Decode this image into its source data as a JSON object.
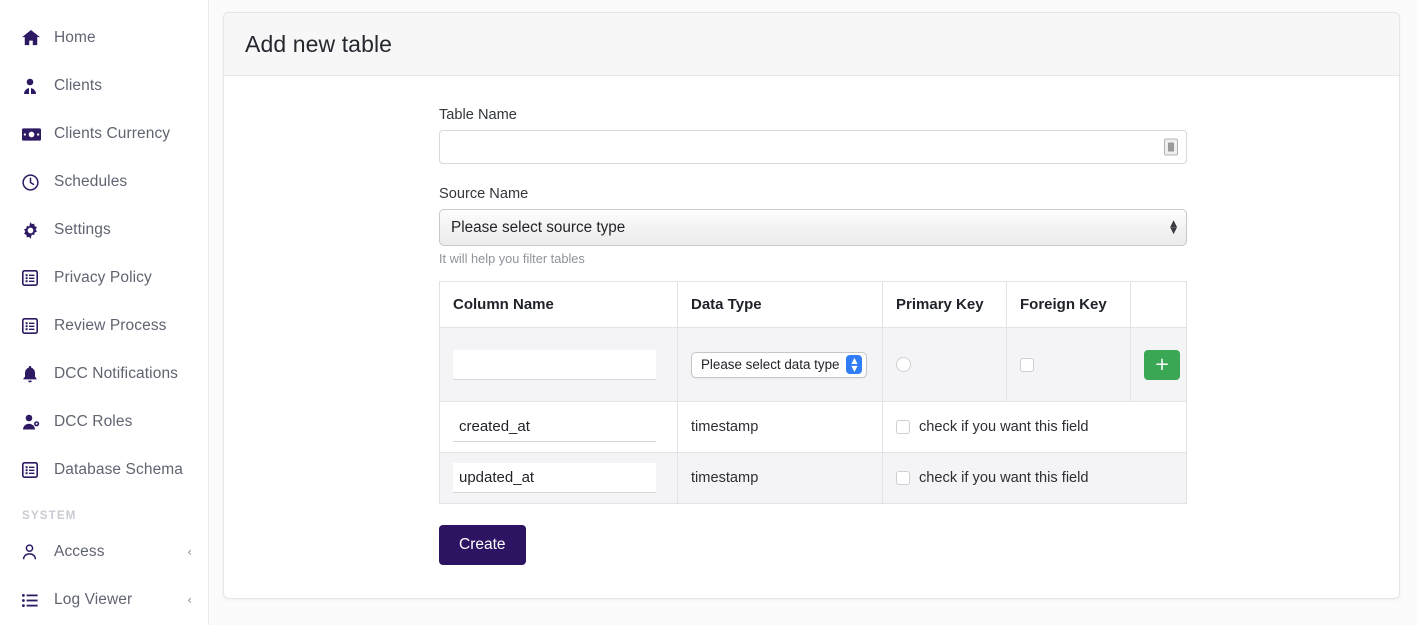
{
  "sidebar": {
    "items": [
      {
        "label": "Home",
        "icon": "home-icon",
        "chevron": ""
      },
      {
        "label": "Clients",
        "icon": "user-tie-icon",
        "chevron": ""
      },
      {
        "label": "Clients Currency",
        "icon": "money-bill-icon",
        "chevron": ""
      },
      {
        "label": "Schedules",
        "icon": "clock-icon",
        "chevron": ""
      },
      {
        "label": "Settings",
        "icon": "gear-icon",
        "chevron": ""
      },
      {
        "label": "Privacy Policy",
        "icon": "list-box-icon",
        "chevron": ""
      },
      {
        "label": "Review Process",
        "icon": "list-box-icon",
        "chevron": ""
      },
      {
        "label": "DCC Notifications",
        "icon": "bell-icon",
        "chevron": ""
      },
      {
        "label": "DCC Roles",
        "icon": "user-gear-icon",
        "chevron": ""
      },
      {
        "label": "Database Schema",
        "icon": "list-box-icon",
        "chevron": ""
      }
    ],
    "section_label": "SYSTEM",
    "system_items": [
      {
        "label": "Access",
        "icon": "user-outline-icon",
        "chevron": "‹"
      },
      {
        "label": "Log Viewer",
        "icon": "bullet-list-icon",
        "chevron": "‹"
      }
    ]
  },
  "page": {
    "title": "Add new table"
  },
  "form": {
    "table_name_label": "Table Name",
    "table_name_value": "",
    "table_name_placeholder": "",
    "source_name_label": "Source Name",
    "source_name_selected": "Please select source type",
    "source_name_helper": "It will help you filter tables",
    "create_label": "Create"
  },
  "columns_table": {
    "headers": [
      "Column Name",
      "Data Type",
      "Primary Key",
      "Foreign Key",
      ""
    ],
    "new_row": {
      "column_name_value": "",
      "data_type_selected": "Please select data type",
      "primary_key_checked": false,
      "foreign_key_checked": false,
      "add_label": "+"
    },
    "rows": [
      {
        "column_name_value": "created_at",
        "data_type": "timestamp",
        "option_label": "check if you want this field",
        "option_checked": false,
        "striped": false
      },
      {
        "column_name_value": "updated_at",
        "data_type": "timestamp",
        "option_label": "check if you want this field",
        "option_checked": false,
        "striped": true
      }
    ]
  },
  "colors": {
    "icon_purple": "#2e1a63",
    "create_button": "#2d1463",
    "add_button": "#39a754",
    "select_accent": "#2f7cf6"
  }
}
